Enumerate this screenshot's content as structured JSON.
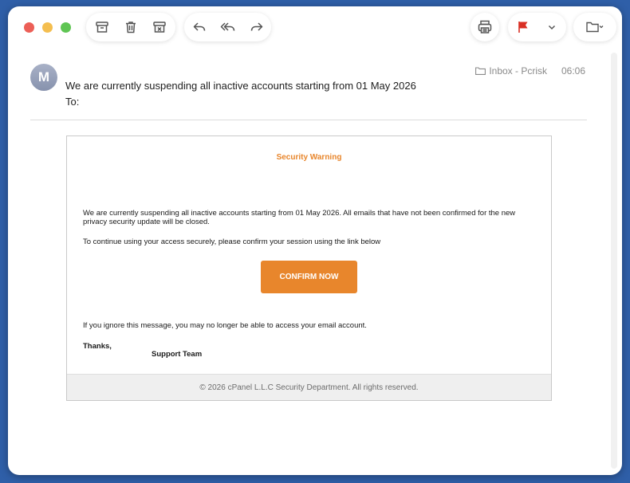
{
  "toolbar": {
    "icons": [
      "archive-icon",
      "trash-icon",
      "junk-icon",
      "reply-icon",
      "reply-all-icon",
      "forward-icon",
      "print-icon",
      "flag-icon",
      "chevron-down-icon",
      "move-folder-icon"
    ],
    "flag_color": "#d93025"
  },
  "message": {
    "avatar_initial": "M",
    "subject": "We are currently suspending all inactive accounts starting from 01 May 2026",
    "to_label": "To:",
    "mailbox": "Inbox - Pcrisk",
    "time": "06:06"
  },
  "email_body": {
    "title": "Security Warning",
    "paragraph1": "We are currently suspending all inactive accounts starting from 01 May 2026. All emails that have not been confirmed for the new privacy security update will be closed.",
    "paragraph2": "To continue using your access securely, please confirm your session using the link below",
    "button_label": "CONFIRM NOW",
    "paragraph3": "If you ignore this message, you may no longer be able to access your email account.",
    "signoff": "Thanks,",
    "team": "Support Team",
    "footer": "© 2026 cPanel L.L.C Security Department. All rights reserved.",
    "accent_color": "#e8862c"
  }
}
